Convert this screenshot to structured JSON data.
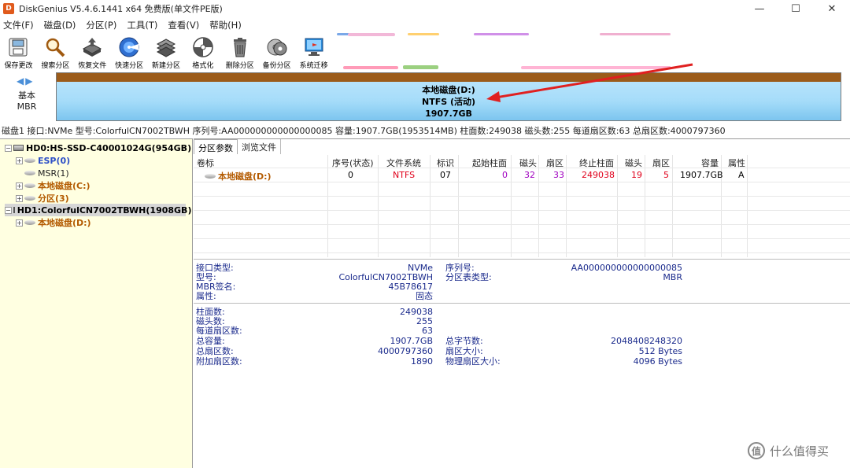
{
  "window": {
    "title": "DiskGenius V5.4.6.1441 x64 免费版(单文件PE版)",
    "app_icon": "D",
    "controls": [
      "—",
      "☐",
      "✕"
    ]
  },
  "menu": [
    "文件(F)",
    "磁盘(D)",
    "分区(P)",
    "工具(T)",
    "查看(V)",
    "帮助(H)"
  ],
  "toolbar": [
    {
      "label": "保存更改",
      "icon": "save-icon"
    },
    {
      "label": "搜索分区",
      "icon": "magnifier-icon"
    },
    {
      "label": "恢复文件",
      "icon": "restore-icon"
    },
    {
      "label": "快速分区",
      "icon": "quick-partition-icon"
    },
    {
      "label": "新建分区",
      "icon": "new-partition-icon"
    },
    {
      "label": "格式化",
      "icon": "format-icon"
    },
    {
      "label": "删除分区",
      "icon": "delete-icon"
    },
    {
      "label": "备份分区",
      "icon": "backup-icon"
    },
    {
      "label": "系统迁移",
      "icon": "migrate-icon"
    }
  ],
  "diskmap": {
    "nav": "◀▶",
    "disk_type_line1": "基本",
    "disk_type_line2": "MBR",
    "partition_name": "本地磁盘(D:)",
    "partition_fs": "NTFS (活动)",
    "partition_size": "1907.7GB"
  },
  "disk_info": "磁盘1 接口:NVMe  型号:ColorfulCN7002TBWH  序列号:AA000000000000000085  容量:1907.7GB(1953514MB)  柱面数:249038  磁头数:255  每道扇区数:63  总扇区数:4000797360",
  "tree": {
    "hd0": "HD0:HS-SSD-C40001024G(954GB)",
    "hd0_parts": [
      "ESP(0)",
      "MSR(1)",
      "本地磁盘(C:)",
      "分区(3)"
    ],
    "hd1": "HD1:ColorfulCN7002TBWH(1908GB)",
    "hd1_parts": [
      "本地磁盘(D:)"
    ]
  },
  "tabs": [
    "分区参数",
    "浏览文件"
  ],
  "grid": {
    "headers": [
      "卷标",
      "序号(状态)",
      "文件系统",
      "标识",
      "起始柱面",
      "磁头",
      "扇区",
      "终止柱面",
      "磁头",
      "扇区",
      "容量",
      "属性"
    ],
    "row": [
      "本地磁盘(D:)",
      "0",
      "NTFS",
      "07",
      "0",
      "32",
      "33",
      "249038",
      "19",
      "5",
      "1907.7GB",
      "A"
    ]
  },
  "details": {
    "left": [
      {
        "label": "接口类型:",
        "value": "NVMe"
      },
      {
        "label": "型号:",
        "value": "ColorfulCN7002TBWH"
      },
      {
        "label": "MBR签名:",
        "value": "45B78617"
      },
      {
        "label": "属性:",
        "value": "固态"
      },
      {
        "label": "柱面数:",
        "value": "249038"
      },
      {
        "label": "磁头数:",
        "value": "255"
      },
      {
        "label": "每道扇区数:",
        "value": "63"
      },
      {
        "label": "总容量:",
        "value": "1907.7GB"
      },
      {
        "label": "总扇区数:",
        "value": "4000797360"
      },
      {
        "label": "附加扇区数:",
        "value": "1890"
      }
    ],
    "right": [
      {
        "label": "序列号:",
        "value": "AA000000000000000085"
      },
      {
        "label": "分区表类型:",
        "value": "MBR"
      },
      {
        "label": "总字节数:",
        "value": "2048408248320"
      },
      {
        "label": "扇区大小:",
        "value": "512 Bytes"
      },
      {
        "label": "物理扇区大小:",
        "value": "4096 Bytes"
      }
    ]
  },
  "watermark": {
    "logo": "值",
    "text": "什么值得买"
  },
  "colors": {
    "accent_blue": "#1a2a8c",
    "fs_red": "#e0001b",
    "num_purple": "#a000c0",
    "partition_orange": "#b35a00",
    "tree_bg": "#ffffe1"
  }
}
